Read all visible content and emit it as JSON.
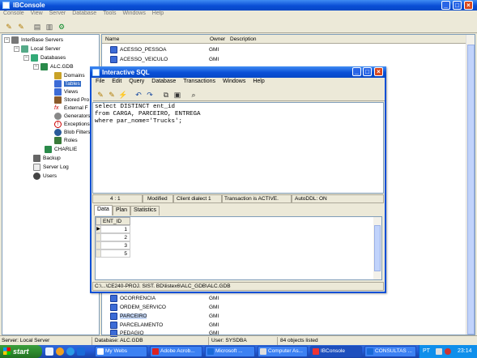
{
  "main": {
    "title": "IBConsole",
    "menu": [
      "Console",
      "View",
      "Server",
      "Database",
      "Tools",
      "Windows",
      "Help"
    ]
  },
  "tree": {
    "nodes": [
      {
        "label": "InterBase Servers",
        "icon": "servers-icon"
      },
      {
        "label": "Local Server",
        "icon": "server-icon"
      },
      {
        "label": "Databases",
        "icon": "databases-icon"
      },
      {
        "label": "ALC.GDB",
        "icon": "database-icon"
      },
      {
        "label": "Domains",
        "icon": "domains-icon"
      },
      {
        "label": "Tables",
        "icon": "tables-icon"
      },
      {
        "label": "Views",
        "icon": "views-icon"
      },
      {
        "label": "Stored Pro",
        "icon": "stored-procedures-icon"
      },
      {
        "label": "External F",
        "icon": "external-functions-icon"
      },
      {
        "label": "Generators",
        "icon": "generators-icon"
      },
      {
        "label": "Exceptions",
        "icon": "exceptions-icon"
      },
      {
        "label": "Blob Filters",
        "icon": "blob-filters-icon"
      },
      {
        "label": "Roles",
        "icon": "roles-icon"
      },
      {
        "label": "CHARLIE",
        "icon": "database-icon"
      },
      {
        "label": "Backup",
        "icon": "backup-icon"
      },
      {
        "label": "Server Log",
        "icon": "server-log-icon"
      },
      {
        "label": "Users",
        "icon": "users-icon"
      }
    ]
  },
  "list": {
    "headers": {
      "name": "Name",
      "owner": "Owner",
      "description": "Description"
    },
    "top_rows": [
      {
        "name": "ACESSO_PESSOA",
        "owner": "GMI"
      },
      {
        "name": "ACESSO_VEICULO",
        "owner": "GMI"
      }
    ],
    "bottom_rows": [
      {
        "name": "OCORRENCIA",
        "owner": "GMI"
      },
      {
        "name": "ORDEM_SERVICO",
        "owner": "GMI"
      },
      {
        "name": "PARCEIRO",
        "owner": "GMI"
      },
      {
        "name": "PARCELAMENTO",
        "owner": "GMI"
      },
      {
        "name": "PEDAGIO",
        "owner": "GMI"
      }
    ]
  },
  "status": {
    "server": "Server: Local Server",
    "database": "Database: ALC.GDB",
    "user": "User: SYSDBA",
    "count": "84 objects listed"
  },
  "sql": {
    "title": "Interactive SQL",
    "menu": [
      "File",
      "Edit",
      "Query",
      "Database",
      "Transactions",
      "Windows",
      "Help"
    ],
    "lines": [
      "select DISTINCT ent_id",
      "from CARGA, PARCEIRO, ENTREGA",
      "where par_nome='Trucks';"
    ],
    "editor_status": {
      "position": "4 : 1",
      "modified": "Modified",
      "dialect": "Client dialect 1",
      "transaction": "Transaction is ACTIVE.",
      "autoddl": "AutoDDL: ON"
    },
    "tabs": [
      "Data",
      "Plan",
      "Statistics"
    ],
    "grid": {
      "column": "ENT_ID",
      "rows": [
        "1",
        "2",
        "3",
        "5"
      ]
    },
    "path": "C:\\...\\CE240-PROJ. SIST. BD\\listex6\\ALC_GDB\\ALC.GDB"
  },
  "taskbar": {
    "start": "start",
    "tasks": [
      "My Webs",
      "Adobe Acrob...",
      "Microsoft ...",
      "Computer As...",
      "IBConsole",
      "CONSULTAS ..."
    ],
    "language": "PT",
    "clock": "23:14"
  }
}
